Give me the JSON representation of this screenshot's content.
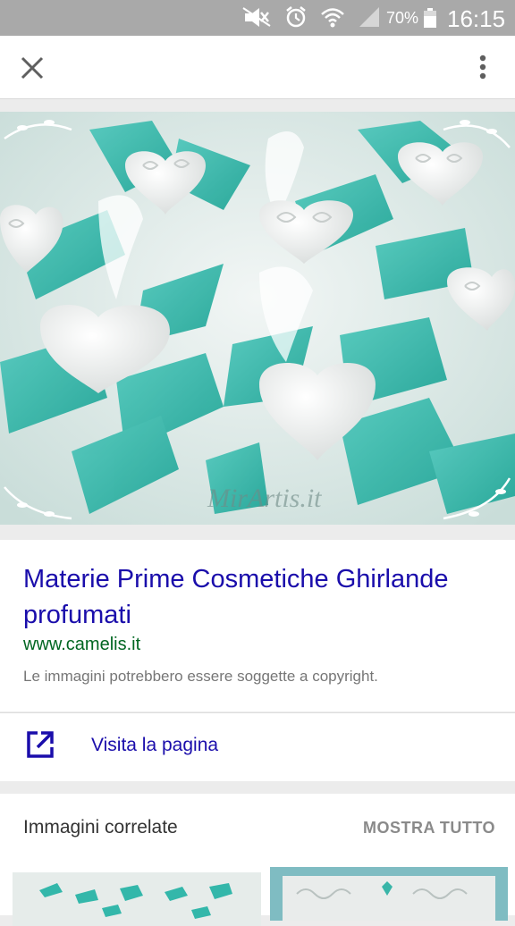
{
  "status_bar": {
    "icons": [
      "mute-icon",
      "alarm-icon",
      "wifi-icon",
      "signal-icon"
    ],
    "battery": "70%",
    "time": "16:15"
  },
  "toolbar": {
    "close_icon": "close-icon",
    "more_icon": "more-vert-icon"
  },
  "image": {
    "watermark": "MirArtis.it",
    "colors": {
      "ribbon": "#3bbcb0",
      "background": "#d7e8e5"
    }
  },
  "result": {
    "title": "Materie Prime Cosmetiche Ghirlande profumati",
    "url": "www.camelis.it",
    "copyright_note": "Le immagini potrebbero essere soggette a copyright."
  },
  "visit": {
    "label": "Visita la pagina",
    "icon": "open-in-new-icon"
  },
  "related": {
    "title": "Immagini correlate",
    "show_all": "MOSTRA TUTTO"
  },
  "colors": {
    "link": "#1a0dab",
    "url": "#006621",
    "status_bar": "#a9a9a9"
  }
}
